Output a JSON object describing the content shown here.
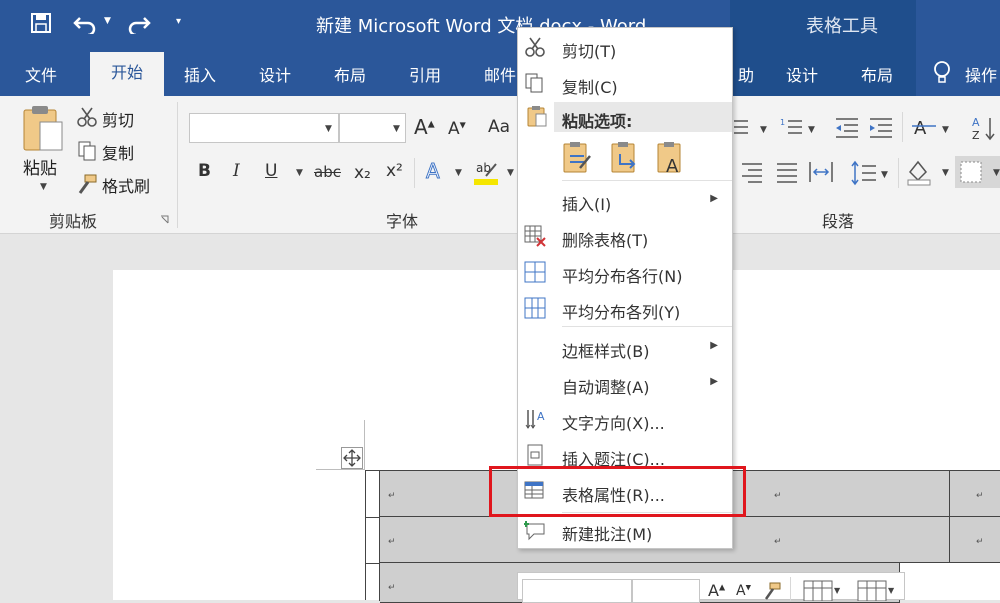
{
  "title_bar": {
    "doc_title": "新建 Microsoft Word 文档.docx  -  Word",
    "context_title": "表格工具"
  },
  "tabs": {
    "file": "文件",
    "home": "开始",
    "insert": "插入",
    "design": "设计",
    "layout": "布局",
    "references": "引用",
    "mailings": "邮件",
    "review_partial": "助",
    "table_design": "设计",
    "table_layout": "布局",
    "tell_me": "操作"
  },
  "ribbon": {
    "clipboard": {
      "paste": "粘贴",
      "cut": "剪切",
      "copy": "复制",
      "format_painter": "格式刷",
      "group_label": "剪贴板"
    },
    "font": {
      "group_label": "字体",
      "aa": "Aa",
      "bold": "B",
      "italic": "I",
      "underline": "U",
      "strike": "abc",
      "subscript": "x₂",
      "superscript": "x²"
    },
    "paragraph": {
      "group_label": "段落"
    }
  },
  "context_menu": {
    "cut": "剪切(T)",
    "copy": "复制(C)",
    "paste_options": "粘贴选项:",
    "insert": "插入(I)",
    "delete_table": "删除表格(T)",
    "distribute_rows": "平均分布各行(N)",
    "distribute_cols": "平均分布各列(Y)",
    "border_styles": "边框样式(B)",
    "autofit": "自动调整(A)",
    "text_direction": "文字方向(X)...",
    "insert_caption": "插入题注(C)...",
    "table_properties": "表格属性(R)...",
    "new_comment": "新建批注(M)"
  },
  "table": {
    "paragraph_mark": "↵"
  },
  "colors": {
    "brand": "#2b579a",
    "highlight_box": "#e0161d",
    "cell_shading": "#cfcfcf"
  }
}
